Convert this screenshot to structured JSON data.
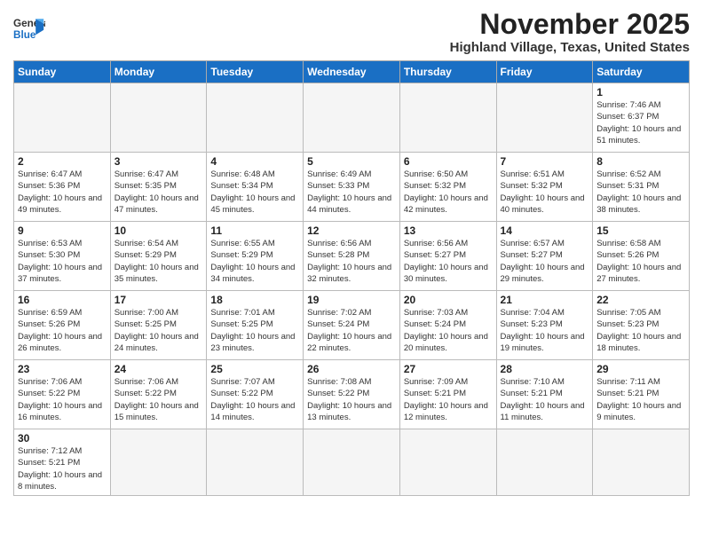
{
  "header": {
    "logo_line1": "General",
    "logo_line2": "Blue",
    "month": "November 2025",
    "location": "Highland Village, Texas, United States"
  },
  "weekdays": [
    "Sunday",
    "Monday",
    "Tuesday",
    "Wednesday",
    "Thursday",
    "Friday",
    "Saturday"
  ],
  "weeks": [
    [
      {
        "day": "",
        "info": ""
      },
      {
        "day": "",
        "info": ""
      },
      {
        "day": "",
        "info": ""
      },
      {
        "day": "",
        "info": ""
      },
      {
        "day": "",
        "info": ""
      },
      {
        "day": "",
        "info": ""
      },
      {
        "day": "1",
        "info": "Sunrise: 7:46 AM\nSunset: 6:37 PM\nDaylight: 10 hours and 51 minutes."
      }
    ],
    [
      {
        "day": "2",
        "info": "Sunrise: 6:47 AM\nSunset: 5:36 PM\nDaylight: 10 hours and 49 minutes."
      },
      {
        "day": "3",
        "info": "Sunrise: 6:47 AM\nSunset: 5:35 PM\nDaylight: 10 hours and 47 minutes."
      },
      {
        "day": "4",
        "info": "Sunrise: 6:48 AM\nSunset: 5:34 PM\nDaylight: 10 hours and 45 minutes."
      },
      {
        "day": "5",
        "info": "Sunrise: 6:49 AM\nSunset: 5:33 PM\nDaylight: 10 hours and 44 minutes."
      },
      {
        "day": "6",
        "info": "Sunrise: 6:50 AM\nSunset: 5:32 PM\nDaylight: 10 hours and 42 minutes."
      },
      {
        "day": "7",
        "info": "Sunrise: 6:51 AM\nSunset: 5:32 PM\nDaylight: 10 hours and 40 minutes."
      },
      {
        "day": "8",
        "info": "Sunrise: 6:52 AM\nSunset: 5:31 PM\nDaylight: 10 hours and 38 minutes."
      }
    ],
    [
      {
        "day": "9",
        "info": "Sunrise: 6:53 AM\nSunset: 5:30 PM\nDaylight: 10 hours and 37 minutes."
      },
      {
        "day": "10",
        "info": "Sunrise: 6:54 AM\nSunset: 5:29 PM\nDaylight: 10 hours and 35 minutes."
      },
      {
        "day": "11",
        "info": "Sunrise: 6:55 AM\nSunset: 5:29 PM\nDaylight: 10 hours and 34 minutes."
      },
      {
        "day": "12",
        "info": "Sunrise: 6:56 AM\nSunset: 5:28 PM\nDaylight: 10 hours and 32 minutes."
      },
      {
        "day": "13",
        "info": "Sunrise: 6:56 AM\nSunset: 5:27 PM\nDaylight: 10 hours and 30 minutes."
      },
      {
        "day": "14",
        "info": "Sunrise: 6:57 AM\nSunset: 5:27 PM\nDaylight: 10 hours and 29 minutes."
      },
      {
        "day": "15",
        "info": "Sunrise: 6:58 AM\nSunset: 5:26 PM\nDaylight: 10 hours and 27 minutes."
      }
    ],
    [
      {
        "day": "16",
        "info": "Sunrise: 6:59 AM\nSunset: 5:26 PM\nDaylight: 10 hours and 26 minutes."
      },
      {
        "day": "17",
        "info": "Sunrise: 7:00 AM\nSunset: 5:25 PM\nDaylight: 10 hours and 24 minutes."
      },
      {
        "day": "18",
        "info": "Sunrise: 7:01 AM\nSunset: 5:25 PM\nDaylight: 10 hours and 23 minutes."
      },
      {
        "day": "19",
        "info": "Sunrise: 7:02 AM\nSunset: 5:24 PM\nDaylight: 10 hours and 22 minutes."
      },
      {
        "day": "20",
        "info": "Sunrise: 7:03 AM\nSunset: 5:24 PM\nDaylight: 10 hours and 20 minutes."
      },
      {
        "day": "21",
        "info": "Sunrise: 7:04 AM\nSunset: 5:23 PM\nDaylight: 10 hours and 19 minutes."
      },
      {
        "day": "22",
        "info": "Sunrise: 7:05 AM\nSunset: 5:23 PM\nDaylight: 10 hours and 18 minutes."
      }
    ],
    [
      {
        "day": "23",
        "info": "Sunrise: 7:06 AM\nSunset: 5:22 PM\nDaylight: 10 hours and 16 minutes."
      },
      {
        "day": "24",
        "info": "Sunrise: 7:06 AM\nSunset: 5:22 PM\nDaylight: 10 hours and 15 minutes."
      },
      {
        "day": "25",
        "info": "Sunrise: 7:07 AM\nSunset: 5:22 PM\nDaylight: 10 hours and 14 minutes."
      },
      {
        "day": "26",
        "info": "Sunrise: 7:08 AM\nSunset: 5:22 PM\nDaylight: 10 hours and 13 minutes."
      },
      {
        "day": "27",
        "info": "Sunrise: 7:09 AM\nSunset: 5:21 PM\nDaylight: 10 hours and 12 minutes."
      },
      {
        "day": "28",
        "info": "Sunrise: 7:10 AM\nSunset: 5:21 PM\nDaylight: 10 hours and 11 minutes."
      },
      {
        "day": "29",
        "info": "Sunrise: 7:11 AM\nSunset: 5:21 PM\nDaylight: 10 hours and 9 minutes."
      }
    ],
    [
      {
        "day": "30",
        "info": "Sunrise: 7:12 AM\nSunset: 5:21 PM\nDaylight: 10 hours and 8 minutes."
      },
      {
        "day": "",
        "info": ""
      },
      {
        "day": "",
        "info": ""
      },
      {
        "day": "",
        "info": ""
      },
      {
        "day": "",
        "info": ""
      },
      {
        "day": "",
        "info": ""
      },
      {
        "day": "",
        "info": ""
      }
    ]
  ]
}
